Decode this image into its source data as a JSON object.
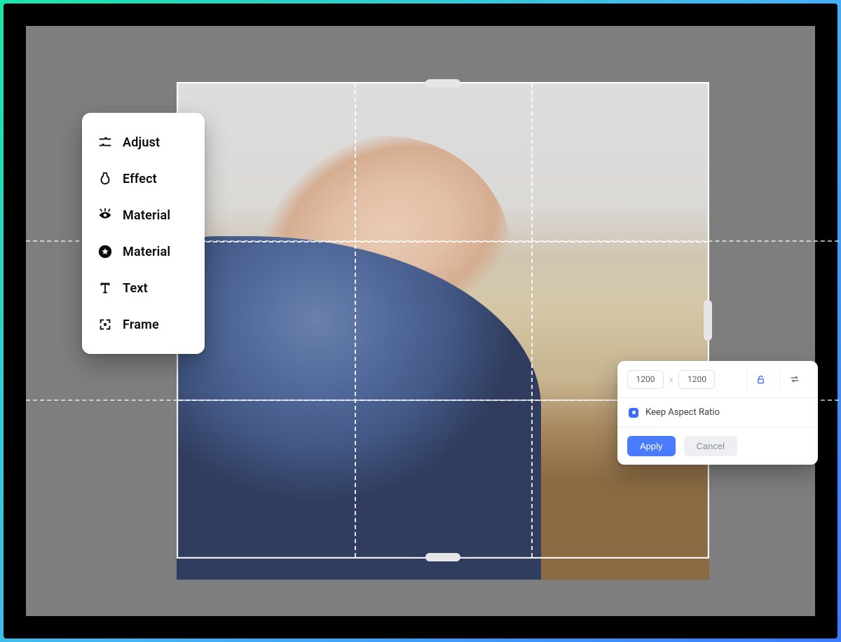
{
  "toolbar": {
    "items": [
      {
        "icon": "adjust-icon",
        "label": "Adjust"
      },
      {
        "icon": "effect-icon",
        "label": "Effect"
      },
      {
        "icon": "eye-material-icon",
        "label": "Material"
      },
      {
        "icon": "star-material-icon",
        "label": "Material"
      },
      {
        "icon": "text-icon",
        "label": "Text"
      },
      {
        "icon": "frame-icon",
        "label": "Frame"
      }
    ]
  },
  "resizePanel": {
    "width": "1200",
    "separator": "x",
    "height": "1200",
    "lockIcon": "lock-icon",
    "swapIcon": "swap-icon",
    "keepAspectLabel": "Keep Aspect Ratio",
    "applyLabel": "Apply",
    "cancelLabel": "Cancel"
  }
}
